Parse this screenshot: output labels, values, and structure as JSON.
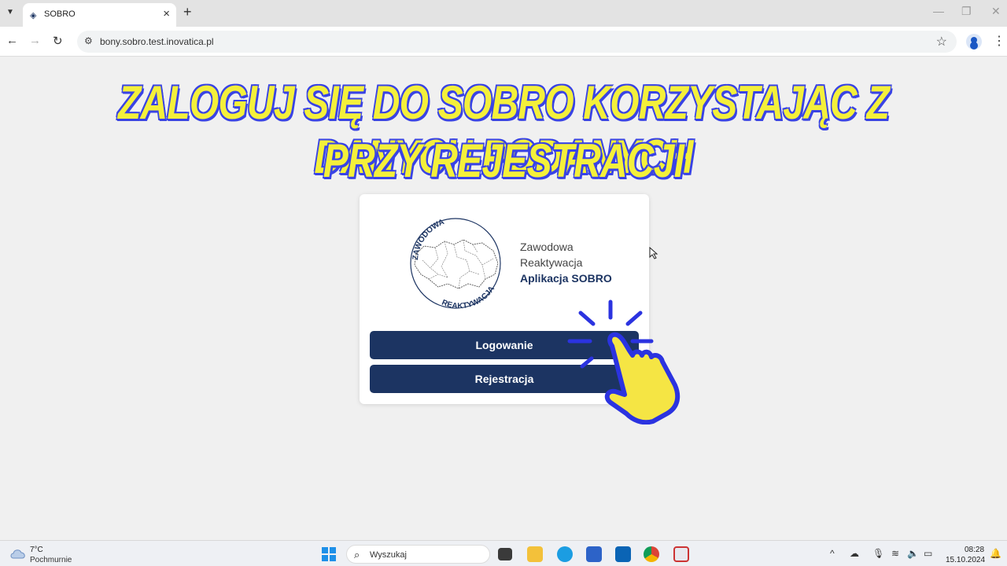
{
  "browser": {
    "tab_title": "SOBRO",
    "url": "bony.sobro.test.inovatica.pl"
  },
  "overlay": {
    "line1": "ZALOGUJ SIĘ DO SOBRO KORZYSTAJĄC Z DANYCH PODANYCH",
    "line2": "PRZY REJESTRACJI"
  },
  "card": {
    "logo_top_text": "ZAWODOWA",
    "logo_bottom_text": "REAKTYWACJA",
    "brand_line1": "Zawodowa",
    "brand_line2": "Reaktywacja",
    "brand_line3": "Aplikacja SOBRO",
    "login_label": "Logowanie",
    "register_label": "Rejestracja"
  },
  "taskbar": {
    "temperature": "7°C",
    "weather": "Pochmurnie",
    "search_label": "Wyszukaj",
    "time": "08:28",
    "date": "15.10.2024"
  },
  "colors": {
    "primary": "#1c3462",
    "headline_fill": "#f4f03a",
    "headline_outline": "#3943e5"
  }
}
